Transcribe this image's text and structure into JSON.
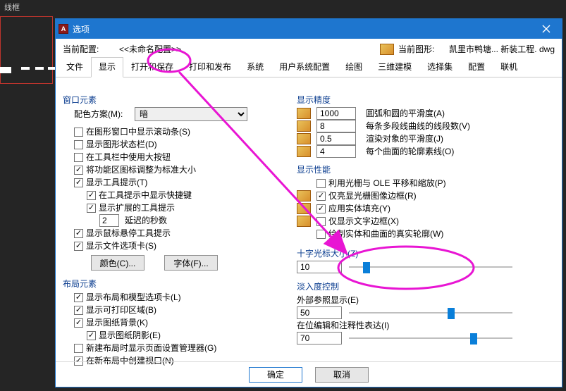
{
  "bg": {
    "label": "线框"
  },
  "titlebar": {
    "title": "选项"
  },
  "topRow": {
    "currentProfileLabel": "当前配置:",
    "currentProfileValue": "<<未命名配置>>",
    "currentDrawingLabel": "当前图形:",
    "currentDrawingValue": "凯里市鸭塘... 新装工程. dwg"
  },
  "tabs": [
    "文件",
    "显示",
    "打开和保存",
    "打印和发布",
    "系统",
    "用户系统配置",
    "绘图",
    "三维建模",
    "选择集",
    "配置",
    "联机"
  ],
  "activeTab": 1,
  "left": {
    "group1Title": "窗口元素",
    "colorSchemeLabel": "配色方案(M):",
    "colorSchemeValue": "暗",
    "chk1": {
      "label": "在图形窗口中显示滚动条(S)",
      "checked": false
    },
    "chk2": {
      "label": "显示图形状态栏(D)",
      "checked": false
    },
    "chk3": {
      "label": "在工具栏中使用大按钮",
      "checked": false
    },
    "chk4": {
      "label": "将功能区图标调整为标准大小",
      "checked": true
    },
    "chk5": {
      "label": "显示工具提示(T)",
      "checked": true
    },
    "chk6": {
      "label": "在工具提示中显示快捷键",
      "checked": true
    },
    "chk7": {
      "label": "显示扩展的工具提示",
      "checked": true
    },
    "delayValue": "2",
    "delayLabel": "延迟的秒数",
    "chk8": {
      "label": "显示鼠标悬停工具提示",
      "checked": true
    },
    "chk9": {
      "label": "显示文件选项卡(S)",
      "checked": true
    },
    "btnColors": "颜色(C)...",
    "btnFonts": "字体(F)...",
    "group2Title": "布局元素",
    "lchk1": {
      "label": "显示布局和模型选项卡(L)",
      "checked": true
    },
    "lchk2": {
      "label": "显示可打印区域(B)",
      "checked": true
    },
    "lchk3": {
      "label": "显示图纸背景(K)",
      "checked": true
    },
    "lchk4": {
      "label": "显示图纸阴影(E)",
      "checked": true
    },
    "lchk5": {
      "label": "新建布局时显示页面设置管理器(G)",
      "checked": false
    },
    "lchk6": {
      "label": "在新布局中创建视口(N)",
      "checked": true
    }
  },
  "right": {
    "group1Title": "显示精度",
    "p1": {
      "value": "1000",
      "label": "圆弧和圆的平滑度(A)"
    },
    "p2": {
      "value": "8",
      "label": "每条多段线曲线的线段数(V)"
    },
    "p3": {
      "value": "0.5",
      "label": "渲染对象的平滑度(J)"
    },
    "p4": {
      "value": "4",
      "label": "每个曲面的轮廓素线(O)"
    },
    "group2Title": "显示性能",
    "q1": {
      "label": "利用光栅与 OLE 平移和缩放(P)",
      "checked": false
    },
    "q2": {
      "label": "仅亮显光栅图像边框(R)",
      "checked": true
    },
    "q3": {
      "label": "应用实体填充(Y)",
      "checked": true
    },
    "q4": {
      "label": "仅显示文字边框(X)",
      "checked": false
    },
    "q5": {
      "label": "绘制实体和曲面的真实轮廓(W)",
      "checked": false
    },
    "crosshairTitle": "十字光标大小(Z)",
    "crosshairValue": "10",
    "fadeTitle": "淡入度控制",
    "xrefLabel": "外部参照显示(E)",
    "xrefValue": "50",
    "inplaceLabel": "在位编辑和注释性表达(I)",
    "inplaceValue": "70"
  },
  "footer": {
    "ok": "确定",
    "cancel": "取消"
  }
}
